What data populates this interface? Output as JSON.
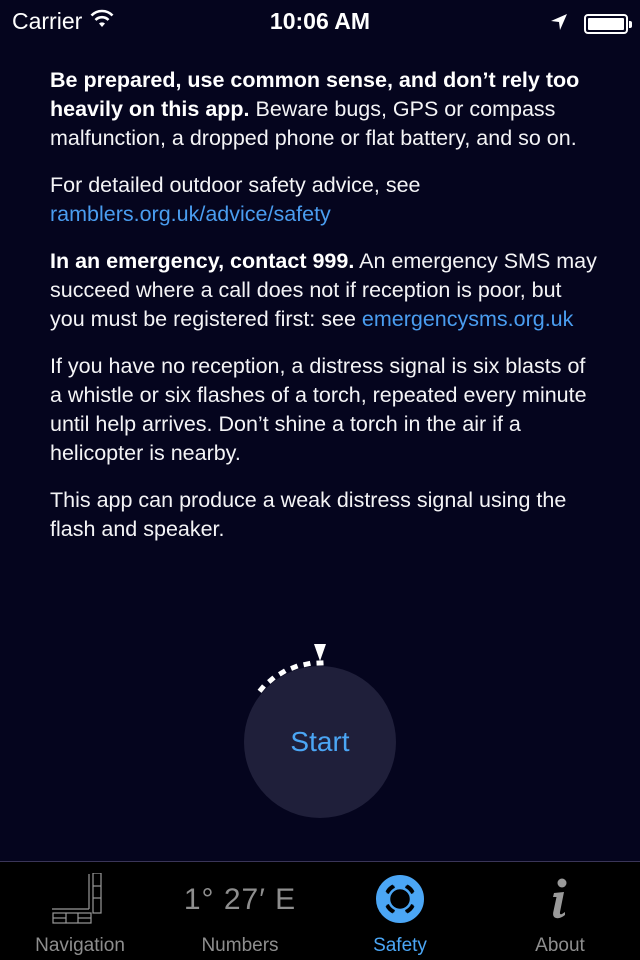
{
  "status_bar": {
    "carrier": "Carrier",
    "time": "10:06 AM",
    "icons": [
      "wifi-icon",
      "location-arrow-icon",
      "battery-icon"
    ]
  },
  "content": {
    "p1": {
      "bold": "Be prepared, use common sense, and don’t rely too heavily on this app.",
      "text": " Beware bugs, GPS or compass malfunction, a dropped phone or flat battery, and so on."
    },
    "p2": {
      "text": "For detailed outdoor safety advice, see ",
      "link": "ramblers.org.uk/advice/safety"
    },
    "p3": {
      "bold": "In an emergency, contact 999.",
      "text": " An emergency SMS may succeed where a call does not if reception is poor, but you must be registered first: see ",
      "link": "emergencysms.org.uk"
    },
    "p4": {
      "text": "If you have no reception, a distress signal is six blasts of a whistle or six flashes of a torch, repeated every minute until help arrives. Don’t shine a torch in the air if a helicopter is nearby."
    },
    "p5": {
      "text": "This app can produce a weak distress signal using the flash and speaker."
    }
  },
  "start_button": {
    "label": "Start",
    "dial_progress_dots": 6
  },
  "tab_bar": {
    "tabs": [
      {
        "label": "Navigation",
        "icon": "navigation-map-icon",
        "active": false
      },
      {
        "label": "Numbers",
        "icon_text": "1° 27′ E",
        "active": false
      },
      {
        "label": "Safety",
        "icon": "lifebuoy-icon",
        "active": true
      },
      {
        "label": "About",
        "icon": "info-icon",
        "active": false
      }
    ]
  },
  "colors": {
    "background": "#05051e",
    "accent": "#4ba6f5",
    "link": "#4a9df0",
    "button_bg": "#1f1f3a",
    "tab_inactive": "#8e8e8e"
  }
}
